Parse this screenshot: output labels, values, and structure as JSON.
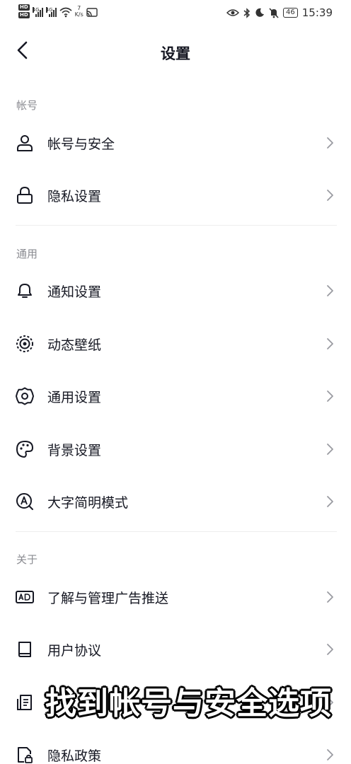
{
  "status_bar": {
    "hd1": "HD",
    "hd2": "HD",
    "net1": "4G",
    "net2": "4G",
    "speed_value": "7",
    "speed_unit": "K/s",
    "battery": "46",
    "time": "15:39"
  },
  "header": {
    "title": "设置"
  },
  "sections": {
    "account": "帐号",
    "general": "通用",
    "about": "关于"
  },
  "items": {
    "account_security": "帐号与安全",
    "privacy_settings": "隐私设置",
    "notification_settings": "通知设置",
    "live_wallpaper": "动态壁纸",
    "general_settings": "通用设置",
    "background_settings": "背景设置",
    "large_text_mode": "大字简明模式",
    "ad_management": "了解与管理广告推送",
    "user_agreement": "用户协议",
    "privacy_policy": "隐私政策"
  },
  "overlay": {
    "caption": "找到帐号与安全选项"
  },
  "icons": {
    "account_security": "person-icon",
    "privacy_settings": "lock-icon",
    "notification_settings": "bell-icon",
    "live_wallpaper": "wallpaper-icon",
    "general_settings": "gear-icon",
    "background_settings": "palette-icon",
    "large_text_mode": "large-text-icon",
    "ad_management": "ad-icon",
    "user_agreement": "book-icon",
    "hidden_item": "document-icon",
    "privacy_policy": "privacy-file-icon"
  }
}
